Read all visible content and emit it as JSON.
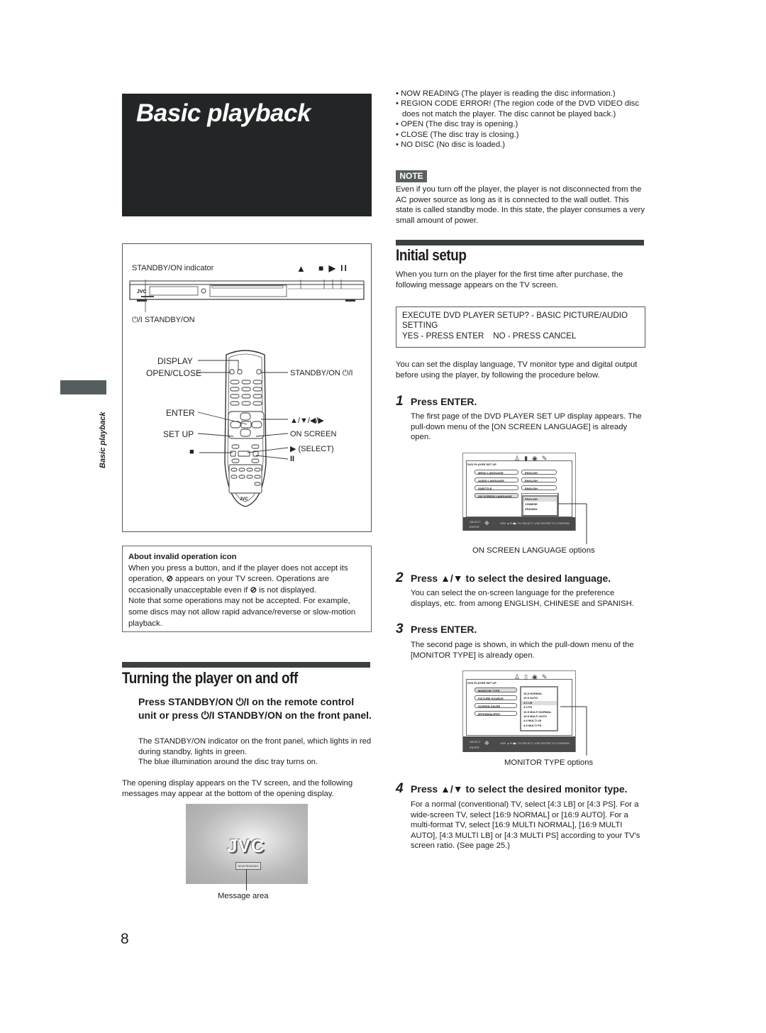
{
  "page": {
    "title": "Basic playback",
    "side_tab_label": "Basic playback",
    "page_number": "8"
  },
  "figure": {
    "player": {
      "standby_indicator_label": "STANDBY/ON indicator",
      "standby_button_label": "STANDBY/ON",
      "power_symbol": "⏻/I",
      "eject_symbol": "▲",
      "transport_symbols": "■ ▶ II",
      "brand": "JVC"
    },
    "remote": {
      "brand": "JVC",
      "labels_left": [
        "DISPLAY",
        "OPEN/CLOSE",
        "ENTER",
        "SET UP",
        "■"
      ],
      "labels_right": [
        "STANDBY/ON ⏻/I",
        "▲/▼/◀/▶",
        "ON SCREEN",
        "▶ (SELECT)",
        "II"
      ]
    }
  },
  "about_box": {
    "heading": "About invalid operation icon",
    "line1": "When you press a button, and if the player does not accept its",
    "line2a": "operation,",
    "line2b": "appears on your TV screen. Operations are",
    "line3a": "occasionally unacceptable even if",
    "line3b": "is not displayed.",
    "line4": "Note that some operations may not be accepted. For example, some discs may not allow rapid advance/reverse or slow-motion playback."
  },
  "turning": {
    "title": "Turning the player on and off",
    "instruction": "Press STANDBY/ON ⏻/I on the remote control unit or press ⏻/I STANDBY/ON on the front panel.",
    "detail1": "The STANDBY/ON indicator on the front panel, which lights in red during standby, lights in green.",
    "detail2": "The blue illumination around the disc tray turns on.",
    "after": "The opening display appears on the TV screen, and the following messages may appear at the bottom of the opening display.",
    "screen_logo": "JVC",
    "screen_message": "NOW READING",
    "caption": "Message area"
  },
  "messages": [
    "NOW READING (The player is reading the disc information.)",
    "REGION CODE ERROR! (The region code of the DVD VIDEO disc does not match the player. The disc cannot be played back.)",
    "OPEN (The disc tray is opening.)",
    "CLOSE (The disc tray is closing.)",
    "NO DISC (No disc is loaded.)"
  ],
  "note": {
    "tag": "NOTE",
    "text": "Even if you turn off the player, the player is not disconnected from the AC power source as long as it is connected to the wall outlet. This state is called standby mode. In this state, the player consumes a very small amount of power."
  },
  "initial_setup": {
    "title": "Initial setup",
    "intro": "When you turn on the player for the first time after purchase, the following message appears on the TV screen.",
    "message_line1": "EXECUTE DVD PLAYER SETUP? - BASIC PICTURE/AUDIO SETTING",
    "message_line2": "YES - PRESS ENTER    NO - PRESS CANCEL",
    "after_message": "You can set the display language, TV monitor type and digital output before using the player, by following the procedure below.",
    "steps": [
      {
        "num": "1",
        "head": "Press ENTER.",
        "text": "The first page of the DVD PLAYER SET UP display appears. The pull-down menu of the [ON SCREEN LANGUAGE] is already open."
      },
      {
        "num": "2",
        "head": "Press ▲/▼ to select the desired language.",
        "text": "You can select the on-screen language for the preference displays, etc. from among ENGLISH, CHINESE and SPANISH."
      },
      {
        "num": "3",
        "head": "Press ENTER.",
        "text": "The second page is shown, in which the pull-down menu of the [MONITOR TYPE] is already open."
      },
      {
        "num": "4",
        "head": "Press ▲/▼ to select the desired monitor type.",
        "text": "For a normal (conventional) TV, select [4:3 LB] or [4:3 PS]. For a wide-screen TV, select [16:9 NORMAL] or [16:9 AUTO]. For a multi-format TV, select [16:9 MULTI NORMAL], [16:9 MULTI AUTO], [4:3 MULTI LB] or [4:3 MULTI PS] according to your TV's screen ratio. (See page 25.)"
      }
    ],
    "osd1": {
      "header": "DVD PLAYER SET UP",
      "rows": [
        {
          "label": "MENU LANGUAGE",
          "value": "ENGLISH"
        },
        {
          "label": "AUDIO LANGUAGE",
          "value": "ENGLISH"
        },
        {
          "label": "SUBTITLE",
          "value": "ENGLISH"
        },
        {
          "label": "ON SCREEN LANGUAGE",
          "value": ""
        }
      ],
      "options": [
        "ENGLISH",
        "CHINESE",
        "SPANISH"
      ],
      "footer_left1": "SELECT",
      "footer_left2": "ENTER",
      "footer_hint": "USE ▲▼◀▶ TO SELECT, USE ENTER TO CONFIRM",
      "caption": "ON SCREEN LANGUAGE options"
    },
    "osd2": {
      "header": "DVD PLAYER SET UP",
      "rows": [
        "MONITOR TYPE",
        "PICTURE SOURCE",
        "SCREEN SAVER",
        "MP3/WMA/JPEG"
      ],
      "options": [
        "16:9 NORMAL",
        "16:9 AUTO",
        "4:3 LB",
        "4:3 PS",
        "16:9 MULTI NORMAL",
        "16:9 MULTI AUTO",
        "4:3 MULTI LB",
        "4:3 MULTI PS"
      ],
      "footer_left1": "SELECT",
      "footer_left2": "ENTER",
      "footer_hint": "USE ▲▼◀▶ TO SELECT, USE ENTER TO CONFIRM",
      "caption": "MONITOR TYPE options"
    }
  }
}
